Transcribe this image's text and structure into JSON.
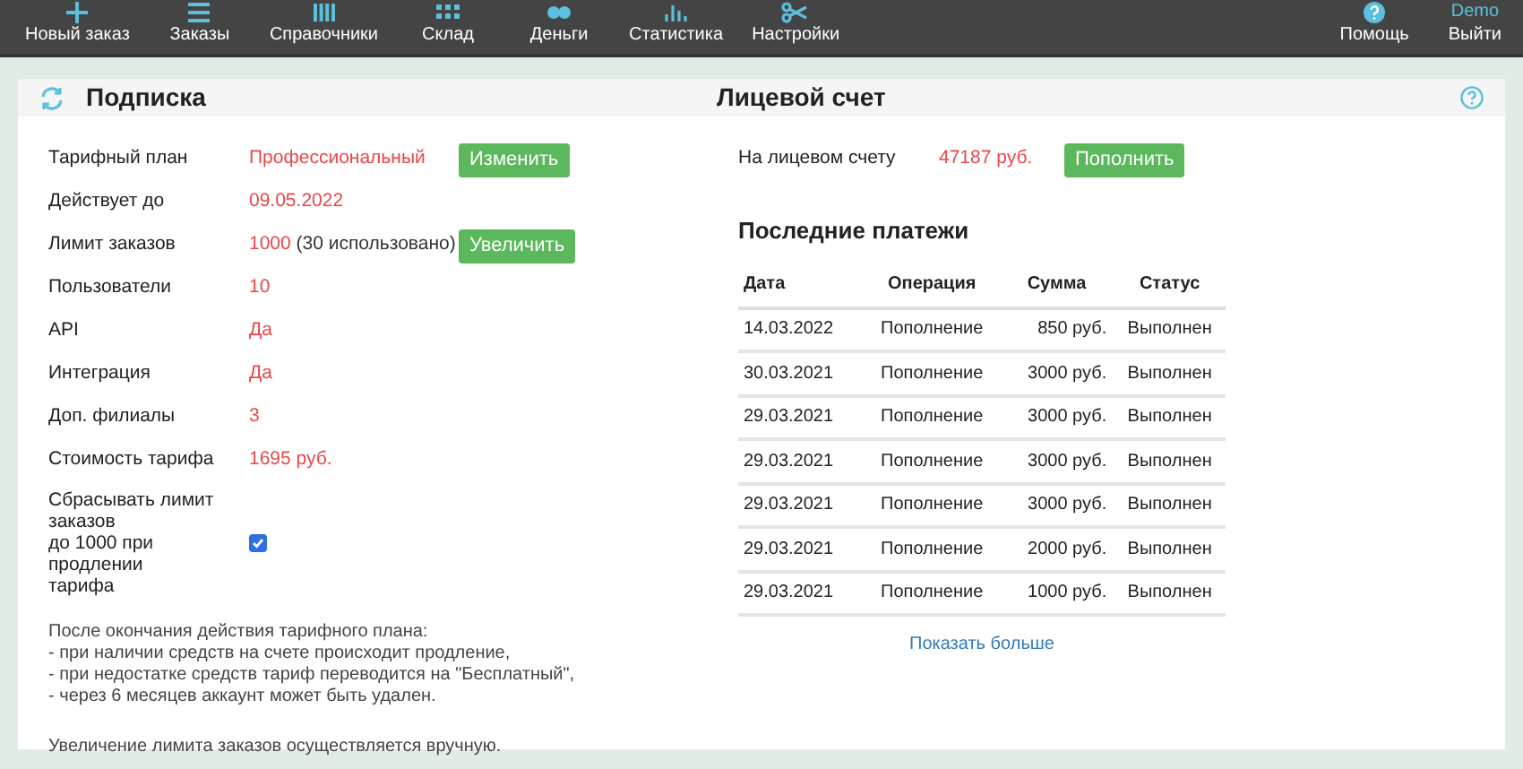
{
  "nav": {
    "items": [
      {
        "label": "Новый заказ",
        "kind": "plus"
      },
      {
        "label": "Заказы",
        "kind": "lines"
      },
      {
        "label": "Справочники",
        "kind": "columns"
      },
      {
        "label": "Склад",
        "kind": "grid"
      },
      {
        "label": "Деньги",
        "kind": "coins"
      },
      {
        "label": "Статистика",
        "kind": "chart"
      },
      {
        "label": "Настройки",
        "kind": "scissors"
      }
    ],
    "help": "Помощь",
    "user": "Demo",
    "logout": "Выйти"
  },
  "subscription": {
    "title": "Подписка",
    "rows": [
      {
        "label": "Тарифный план",
        "value": "Профессиональный",
        "button": "Изменить"
      },
      {
        "label": "Действует до",
        "value": "09.05.2022"
      },
      {
        "label": "Лимит заказов",
        "value": "1000",
        "note": "(30 использовано)",
        "button": "Увеличить"
      },
      {
        "label": "Пользователи",
        "value": "10"
      },
      {
        "label": "API",
        "value": "Да"
      },
      {
        "label": "Интеграция",
        "value": "Да"
      },
      {
        "label": "Доп. филиалы",
        "value": "3"
      },
      {
        "label": "Стоимость тарифа",
        "value": "1695 руб."
      }
    ],
    "reset": {
      "label_lines": [
        "Сбрасывать лимит",
        "заказов",
        "до 1000 при продлении",
        "тарифа"
      ],
      "checked": true
    },
    "info_lines": [
      "После окончания действия тарифного плана:",
      "- при наличии средств на счете происходит продление,",
      "- при недостатке средств тариф переводится на \"Бесплатный\",",
      "- через 6 месяцев аккаунт может быть удален."
    ],
    "note": "Увеличение лимита заказов осуществляется вручную."
  },
  "account": {
    "title": "Лицевой счет",
    "balance_label": "На лицевом счету",
    "balance": "47187 руб.",
    "topup": "Пополнить",
    "payments_title": "Последние платежи",
    "table": {
      "columns": [
        "Дата",
        "Операция",
        "Сумма",
        "Статус"
      ],
      "rows": [
        [
          "14.03.2022",
          "Пополнение",
          "850 руб.",
          "Выполнен"
        ],
        [
          "30.03.2021",
          "Пополнение",
          "3000 руб.",
          "Выполнен"
        ],
        [
          "29.03.2021",
          "Пополнение",
          "3000 руб.",
          "Выполнен"
        ],
        [
          "29.03.2021",
          "Пополнение",
          "3000 руб.",
          "Выполнен"
        ],
        [
          "29.03.2021",
          "Пополнение",
          "3000 руб.",
          "Выполнен"
        ],
        [
          "29.03.2021",
          "Пополнение",
          "2000 руб.",
          "Выполнен"
        ],
        [
          "29.03.2021",
          "Пополнение",
          "1000 руб.",
          "Выполнен"
        ]
      ]
    },
    "show_more": "Показать больше"
  }
}
